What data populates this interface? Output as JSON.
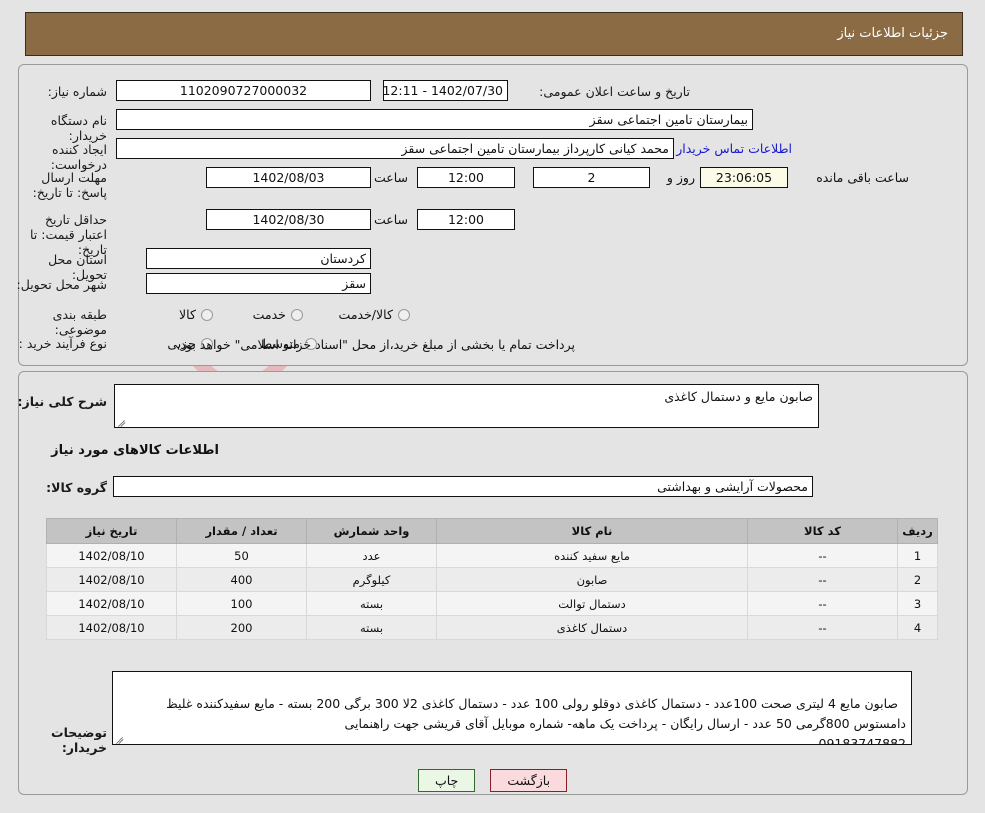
{
  "header": {
    "title": "جزئیات اطلاعات نیاز"
  },
  "colors": {
    "header_bg": "#8b6b43",
    "page_bg": "#e4e4e4",
    "link": "#1818d0",
    "countdown_bg": "#fcfbe8",
    "print_btn_bg": "#e9f7e4",
    "back_btn_bg": "#fadadd"
  },
  "watermark": {
    "text": "AriaTender.net"
  },
  "top_section": {
    "need_number": {
      "label": "شماره نیاز:",
      "value": "1102090727000032"
    },
    "public_announce": {
      "label": "تاریخ و ساعت اعلان عمومی:",
      "value": "1402/07/30 - 12:11"
    },
    "buyer_org": {
      "label": "نام دستگاه خریدار:",
      "value": "بیمارستان تامین اجتماعی سقز"
    },
    "requester": {
      "label": "ایجاد کننده درخواست:",
      "value": "محمد کیانی کارپرداز بیمارستان تامین اجتماعی سقز"
    },
    "contact_link": "اطلاعات تماس خریدار",
    "response_deadline": {
      "label": "مهلت ارسال پاسخ: تا تاریخ:",
      "date": "1402/08/03",
      "hour_label": "ساعت",
      "hour": "12:00",
      "days": "2",
      "days_suffix": "روز و",
      "countdown": "23:06:05",
      "countdown_suffix": "ساعت باقی مانده"
    },
    "price_validity": {
      "label": "حداقل تاریخ اعتبار قیمت: تا تاریخ:",
      "date": "1402/08/30",
      "hour_label": "ساعت",
      "hour": "12:00"
    },
    "delivery_province": {
      "label": "استان محل تحویل:",
      "value": "کردستان"
    },
    "delivery_city": {
      "label": "شهر محل تحویل:",
      "value": "سقز"
    },
    "classification": {
      "label": "طبقه بندی موضوعی:",
      "options": [
        "کالا",
        "خدمت",
        "کالا/خدمت"
      ],
      "selected": null
    },
    "process_type": {
      "label": "نوع فرآیند خرید :",
      "options": [
        "جزیی",
        "متوسط"
      ],
      "selected": null,
      "note": "پرداخت تمام یا بخشی از مبلغ خرید،از محل \"اسناد خزانه اسلامی\" خواهد بود."
    }
  },
  "bottom_section": {
    "general_desc": {
      "label": "شرح کلی نیاز:",
      "value": "صابون مایع و دستمال کاغذی"
    },
    "goods_heading": "اطلاعات کالاهای مورد نیاز",
    "goods_group": {
      "label": "گروه کالا:",
      "value": "محصولات آرایشی و بهداشتی"
    },
    "table": {
      "headers": [
        "ردیف",
        "کد کالا",
        "نام کالا",
        "واحد شمارش",
        "تعداد / مقدار",
        "تاریخ نیاز"
      ],
      "rows": [
        {
          "row": "1",
          "code": "--",
          "name": "مایع سفید کننده",
          "unit": "عدد",
          "qty": "50",
          "date": "1402/08/10"
        },
        {
          "row": "2",
          "code": "--",
          "name": "صابون",
          "unit": "کیلوگرم",
          "qty": "400",
          "date": "1402/08/10"
        },
        {
          "row": "3",
          "code": "--",
          "name": "دستمال توالت",
          "unit": "بسته",
          "qty": "100",
          "date": "1402/08/10"
        },
        {
          "row": "4",
          "code": "--",
          "name": "دستمال کاغذی",
          "unit": "بسته",
          "qty": "200",
          "date": "1402/08/10"
        }
      ]
    },
    "buyer_notes": {
      "label": "توضیحات خریدار:",
      "value": "صابون مایع 4 لیتری صحت 100عدد - دستمال کاغذی دوقلو رولی 100 عدد - دستمال کاغذی 2لا 300 برگی 200 بسته - مایع سفیدکننده غلیظ دامستوس 800گرمی 50 عدد - ارسال رایگان - پرداخت یک ماهه- شماره موبایل آقای قریشی جهت راهنمایی\n09183747882"
    }
  },
  "buttons": {
    "print": "چاپ",
    "back": "بازگشت"
  }
}
